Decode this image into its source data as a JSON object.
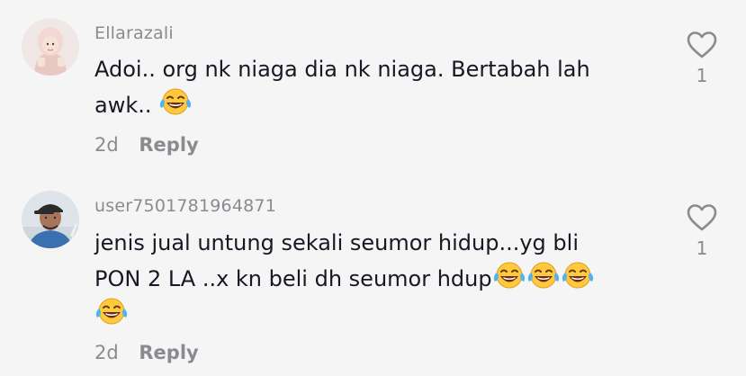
{
  "comments": [
    {
      "username": "Ellarazali",
      "text_lines": [
        "Adoi.. org nk niaga dia nk niaga. Bertabah lah",
        "awk.."
      ],
      "date": "2d",
      "reply_label": "Reply",
      "likes": "1",
      "avatar": "avatar-woman-hijab"
    },
    {
      "username": "user7501781964871",
      "text_lines": [
        "jenis jual untung sekali seumor hidup...yg bli",
        "PON 2 LA ..x kn beli dh seumor hdup"
      ],
      "date": "2d",
      "reply_label": "Reply",
      "likes": "1",
      "avatar": "avatar-man-cap"
    }
  ],
  "icons": {
    "like": "heart-outline-icon",
    "emoji": "face-with-tears-of-joy-icon"
  },
  "colors": {
    "background": "#f5f5f5",
    "text": "#161823",
    "muted": "#8a8b91"
  }
}
